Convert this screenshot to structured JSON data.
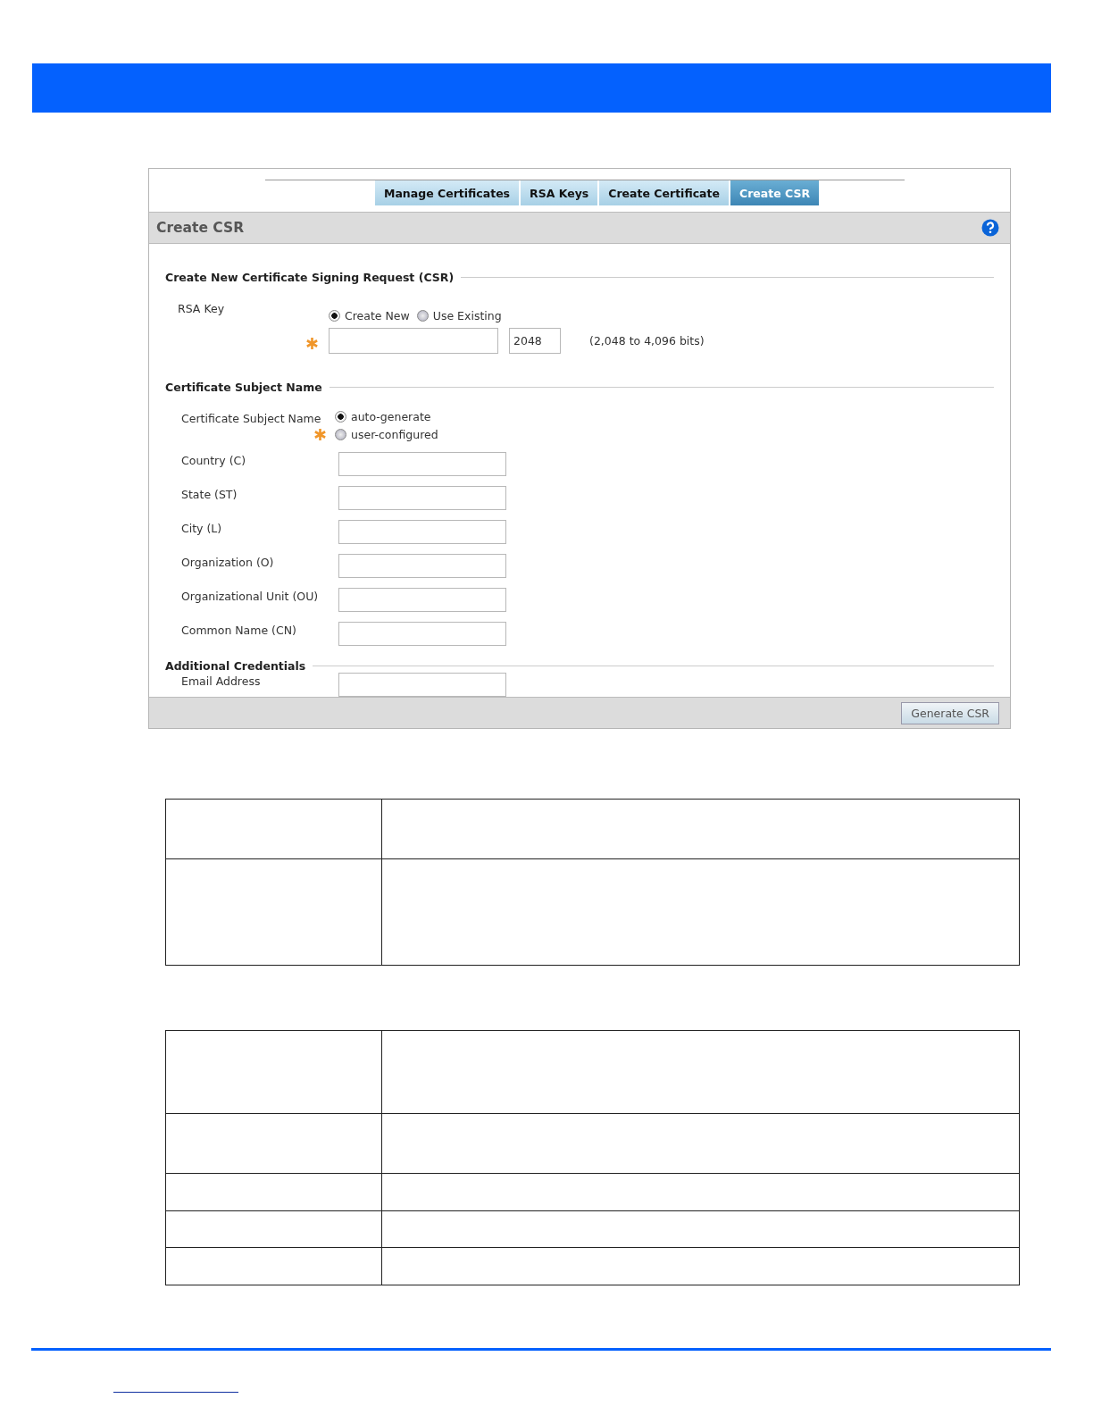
{
  "tabs": [
    {
      "label": "Manage Certificates",
      "selected": false
    },
    {
      "label": "RSA Keys",
      "selected": false
    },
    {
      "label": "Create Certificate",
      "selected": false
    },
    {
      "label": "Create CSR",
      "selected": true
    }
  ],
  "panel_title": "Create CSR",
  "sections": [
    {
      "title": "Create New Certificate Signing Request (CSR)",
      "rsa_key": {
        "label": "RSA Key",
        "options": [
          {
            "label": "Create New",
            "selected": true
          },
          {
            "label": "Use Existing",
            "selected": false
          }
        ],
        "key_size": "2048",
        "range_hint": "(2,048 to 4,096 bits)"
      }
    },
    {
      "title": "Certificate Subject Name",
      "subject": {
        "label": "Certificate Subject Name",
        "options": [
          {
            "label": "auto-generate",
            "selected": true
          },
          {
            "label": "user-configured",
            "selected": false
          }
        ]
      },
      "fields": [
        {
          "label": "Country (C)"
        },
        {
          "label": "State (ST)"
        },
        {
          "label": "City (L)"
        },
        {
          "label": "Organization (O)"
        },
        {
          "label": "Organizational Unit (OU)"
        },
        {
          "label": "Common Name (CN)"
        }
      ]
    },
    {
      "title": "Additional Credentials",
      "fields": [
        {
          "label": "Email Address"
        }
      ]
    }
  ],
  "footer_button": "Generate CSR"
}
